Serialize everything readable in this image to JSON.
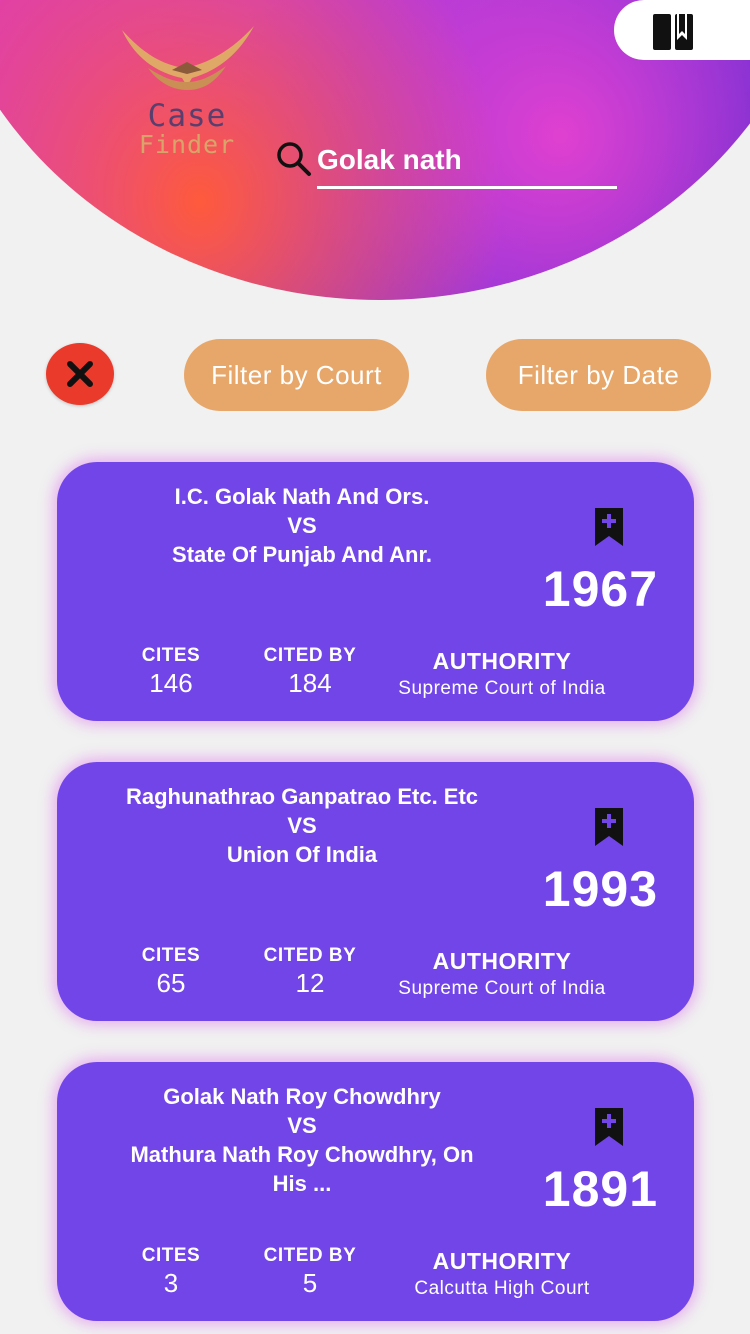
{
  "app": {
    "logo_line1": "Case",
    "logo_line2": "Finder",
    "brand_colors": {
      "logo_gold": "#d9a46a",
      "logo_dark": "#5a3f6e"
    }
  },
  "search": {
    "value": "Golak nath",
    "icon": "search-icon"
  },
  "header_actions": {
    "bookmarks_icon": "bookmarks-book-icon"
  },
  "filters": {
    "clear_icon": "close-icon",
    "court_label": "Filter by Court",
    "date_label": "Filter by Date"
  },
  "results": [
    {
      "title_line1": "I.C. Golak Nath And Ors.",
      "title_line2": "VS",
      "title_line3": "State Of Punjab And Anr.",
      "title_line4": "",
      "year": "1967",
      "cites_label": "CITES",
      "cites": "146",
      "cited_by_label": "CITED BY",
      "cited_by": "184",
      "authority_label": "AUTHORITY",
      "authority": "Supreme Court of India"
    },
    {
      "title_line1": "Raghunathrao Ganpatrao Etc. Etc",
      "title_line2": "VS",
      "title_line3": "Union Of India",
      "title_line4": "",
      "year": "1993",
      "cites_label": "CITES",
      "cites": "65",
      "cited_by_label": "CITED BY",
      "cited_by": "12",
      "authority_label": "AUTHORITY",
      "authority": "Supreme Court of India"
    },
    {
      "title_line1": "Golak Nath Roy Chowdhry",
      "title_line2": "VS",
      "title_line3": "Mathura Nath Roy Chowdhry, On",
      "title_line4": "His ...",
      "year": "1891",
      "cites_label": "CITES",
      "cites": "3",
      "cited_by_label": "CITED BY",
      "cited_by": "5",
      "authority_label": "AUTHORITY",
      "authority": "Calcutta High Court"
    }
  ],
  "colors": {
    "card_bg": "#7245e8",
    "filter_bg": "#e7a76a",
    "clear_bg": "#ea3a2b",
    "page_bg": "#f1f1f1"
  }
}
